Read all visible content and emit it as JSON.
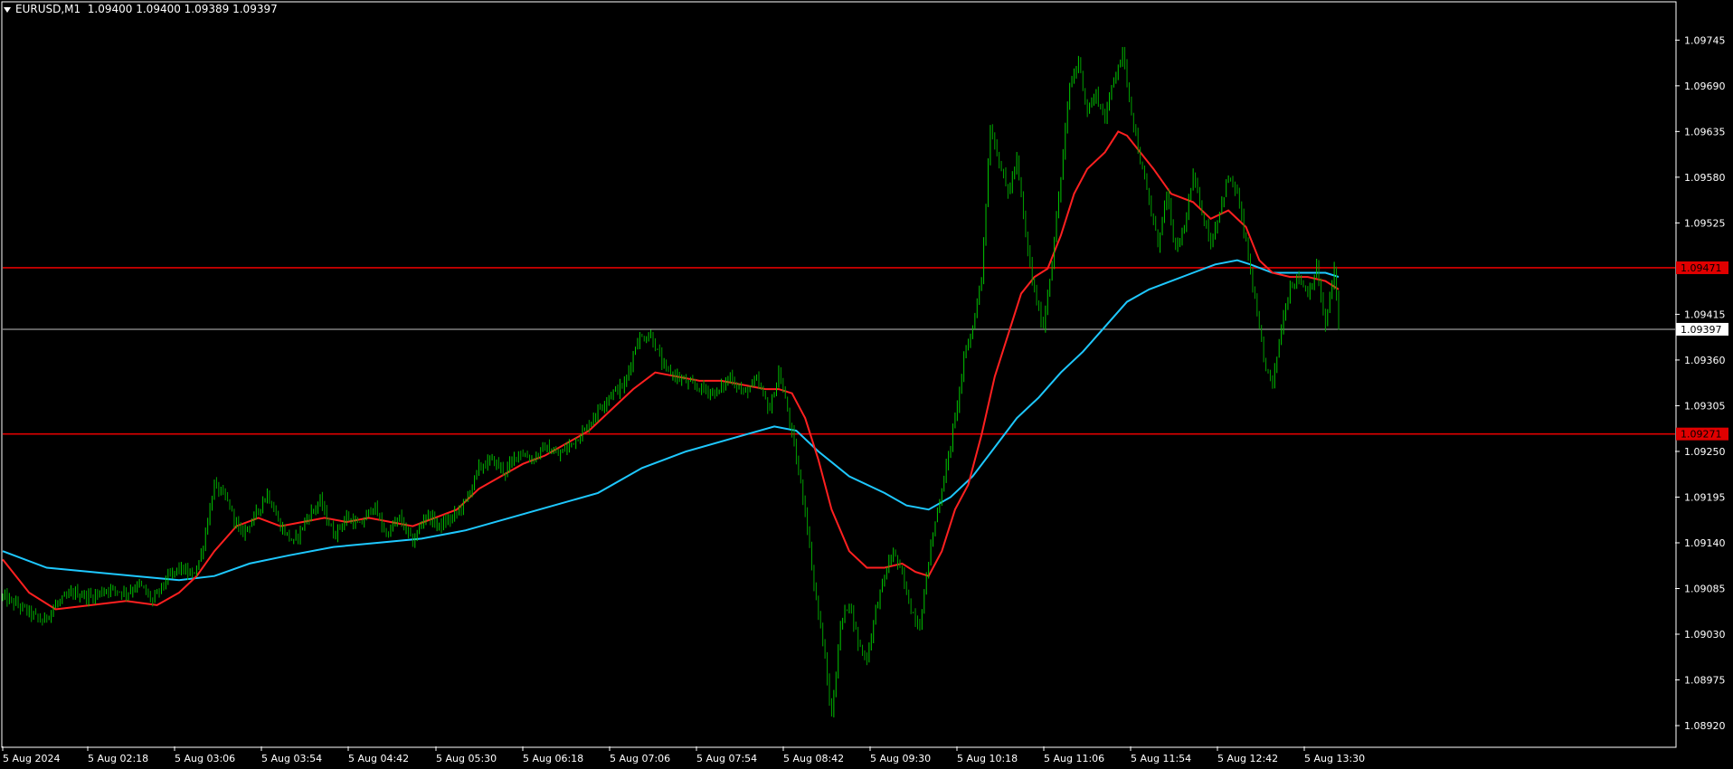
{
  "header": {
    "symbol": "EURUSD,M1",
    "ohlc": "1.09400 1.09400 1.09389 1.09397"
  },
  "colors": {
    "background": "#000000",
    "frame": "#ffffff",
    "candle_bull": "#00c800",
    "candle_bear": "#00a000",
    "ma_fast": "#ff2020",
    "ma_slow": "#1ec8ff",
    "hline": "#e00000",
    "price_line": "#bfbfbf",
    "label_red_bg": "#e00000",
    "label_white_bg": "#ffffff"
  },
  "chart_data": {
    "type": "candlestick",
    "ylim": [
      1.08895,
      1.0979
    ],
    "y_ticks": [
      "1.09745",
      "1.09690",
      "1.09635",
      "1.09580",
      "1.09525",
      "1.09415",
      "1.09360",
      "1.09305",
      "1.09250",
      "1.09195",
      "1.09140",
      "1.09085",
      "1.09030",
      "1.08975",
      "1.08920"
    ],
    "x_ticks": [
      "5 Aug 2024",
      "5 Aug 02:18",
      "5 Aug 03:06",
      "5 Aug 03:54",
      "5 Aug 04:42",
      "5 Aug 05:30",
      "5 Aug 06:18",
      "5 Aug 07:06",
      "5 Aug 07:54",
      "5 Aug 08:42",
      "5 Aug 09:30",
      "5 Aug 10:18",
      "5 Aug 11:06",
      "5 Aug 11:54",
      "5 Aug 12:42",
      "5 Aug 13:30"
    ],
    "horizontal_lines": [
      {
        "label": "1.09471",
        "value": 1.09471,
        "style": "red"
      },
      {
        "label": "1.09271",
        "value": 1.09271,
        "style": "red"
      }
    ],
    "current_price": {
      "label": "1.09397",
      "value": 1.09397
    },
    "price_path": [
      [
        0,
        1.09075
      ],
      [
        10,
        1.0906
      ],
      [
        18,
        1.09045
      ],
      [
        24,
        1.09065
      ],
      [
        32,
        1.0908
      ],
      [
        40,
        1.09075
      ],
      [
        48,
        1.09085
      ],
      [
        56,
        1.0908
      ],
      [
        62,
        1.0909
      ],
      [
        68,
        1.0907
      ],
      [
        74,
        1.09095
      ],
      [
        80,
        1.0911
      ],
      [
        86,
        1.091
      ],
      [
        90,
        1.09125
      ],
      [
        96,
        1.0921
      ],
      [
        102,
        1.0919
      ],
      [
        108,
        1.0915
      ],
      [
        114,
        1.0917
      ],
      [
        120,
        1.092
      ],
      [
        126,
        1.0916
      ],
      [
        132,
        1.0914
      ],
      [
        138,
        1.0917
      ],
      [
        144,
        1.0919
      ],
      [
        150,
        1.0915
      ],
      [
        156,
        1.0917
      ],
      [
        162,
        1.0916
      ],
      [
        168,
        1.09185
      ],
      [
        174,
        1.0915
      ],
      [
        180,
        1.0917
      ],
      [
        186,
        1.0914
      ],
      [
        192,
        1.09175
      ],
      [
        198,
        1.0916
      ],
      [
        204,
        1.0917
      ],
      [
        210,
        1.0919
      ],
      [
        216,
        1.0923
      ],
      [
        222,
        1.0924
      ],
      [
        228,
        1.09225
      ],
      [
        234,
        1.0925
      ],
      [
        240,
        1.0924
      ],
      [
        246,
        1.09255
      ],
      [
        252,
        1.09245
      ],
      [
        258,
        1.0926
      ],
      [
        264,
        1.09275
      ],
      [
        270,
        1.093
      ],
      [
        276,
        1.0932
      ],
      [
        282,
        1.0933
      ],
      [
        288,
        1.09385
      ],
      [
        294,
        1.0939
      ],
      [
        300,
        1.0935
      ],
      [
        306,
        1.0934
      ],
      [
        312,
        1.0933
      ],
      [
        318,
        1.09325
      ],
      [
        324,
        1.0932
      ],
      [
        330,
        1.0934
      ],
      [
        336,
        1.0932
      ],
      [
        342,
        1.09335
      ],
      [
        348,
        1.093
      ],
      [
        352,
        1.09345
      ],
      [
        356,
        1.093
      ],
      [
        360,
        1.0924
      ],
      [
        364,
        1.0918
      ],
      [
        368,
        1.0909
      ],
      [
        372,
        1.0902
      ],
      [
        376,
        1.0893
      ],
      [
        380,
        1.0904
      ],
      [
        384,
        1.0907
      ],
      [
        388,
        1.0902
      ],
      [
        392,
        1.09
      ],
      [
        396,
        1.0906
      ],
      [
        400,
        1.091
      ],
      [
        404,
        1.0913
      ],
      [
        408,
        1.091
      ],
      [
        412,
        1.0906
      ],
      [
        416,
        1.0904
      ],
      [
        420,
        1.0912
      ],
      [
        424,
        1.0918
      ],
      [
        428,
        1.0923
      ],
      [
        432,
        1.0929
      ],
      [
        436,
        1.0936
      ],
      [
        440,
        1.094
      ],
      [
        444,
        1.0946
      ],
      [
        448,
        1.0964
      ],
      [
        452,
        1.096
      ],
      [
        456,
        1.0956
      ],
      [
        460,
        1.096
      ],
      [
        464,
        1.0951
      ],
      [
        468,
        1.0944
      ],
      [
        472,
        1.094
      ],
      [
        476,
        1.0948
      ],
      [
        480,
        1.0958
      ],
      [
        484,
        1.0969
      ],
      [
        488,
        1.0972
      ],
      [
        492,
        1.0966
      ],
      [
        496,
        1.0968
      ],
      [
        500,
        1.0965
      ],
      [
        504,
        1.097
      ],
      [
        508,
        1.0973
      ],
      [
        512,
        1.0966
      ],
      [
        516,
        1.096
      ],
      [
        520,
        1.0955
      ],
      [
        524,
        1.095
      ],
      [
        528,
        1.0956
      ],
      [
        532,
        1.0949
      ],
      [
        536,
        1.0952
      ],
      [
        540,
        1.0958
      ],
      [
        544,
        1.0954
      ],
      [
        548,
        1.095
      ],
      [
        552,
        1.0954
      ],
      [
        556,
        1.0958
      ],
      [
        560,
        1.0956
      ],
      [
        564,
        1.095
      ],
      [
        568,
        1.0943
      ],
      [
        572,
        1.0936
      ],
      [
        576,
        1.0933
      ],
      [
        580,
        1.094
      ],
      [
        584,
        1.0945
      ],
      [
        588,
        1.0946
      ],
      [
        592,
        1.0944
      ],
      [
        596,
        1.0947
      ],
      [
        600,
        1.094
      ],
      [
        604,
        1.0947
      ],
      [
        606,
        1.09397
      ]
    ],
    "ma_fast_path": [
      [
        0,
        1.0912
      ],
      [
        12,
        1.0908
      ],
      [
        24,
        1.0906
      ],
      [
        40,
        1.09065
      ],
      [
        56,
        1.0907
      ],
      [
        70,
        1.09065
      ],
      [
        80,
        1.0908
      ],
      [
        88,
        1.091
      ],
      [
        96,
        1.0913
      ],
      [
        106,
        1.0916
      ],
      [
        116,
        1.0917
      ],
      [
        126,
        1.0916
      ],
      [
        136,
        1.09165
      ],
      [
        146,
        1.0917
      ],
      [
        156,
        1.09165
      ],
      [
        166,
        1.0917
      ],
      [
        176,
        1.09165
      ],
      [
        186,
        1.0916
      ],
      [
        196,
        1.0917
      ],
      [
        206,
        1.0918
      ],
      [
        216,
        1.09205
      ],
      [
        226,
        1.0922
      ],
      [
        236,
        1.09235
      ],
      [
        246,
        1.09245
      ],
      [
        256,
        1.0926
      ],
      [
        266,
        1.09275
      ],
      [
        276,
        1.093
      ],
      [
        286,
        1.09325
      ],
      [
        296,
        1.09345
      ],
      [
        306,
        1.0934
      ],
      [
        316,
        1.09335
      ],
      [
        326,
        1.09335
      ],
      [
        336,
        1.0933
      ],
      [
        346,
        1.09325
      ],
      [
        352,
        1.09325
      ],
      [
        358,
        1.0932
      ],
      [
        364,
        1.0929
      ],
      [
        370,
        1.0924
      ],
      [
        376,
        1.0918
      ],
      [
        384,
        1.0913
      ],
      [
        392,
        1.0911
      ],
      [
        400,
        1.0911
      ],
      [
        408,
        1.09115
      ],
      [
        414,
        1.09105
      ],
      [
        420,
        1.091
      ],
      [
        426,
        1.0913
      ],
      [
        432,
        1.0918
      ],
      [
        438,
        1.0921
      ],
      [
        444,
        1.0927
      ],
      [
        450,
        1.0934
      ],
      [
        456,
        1.0939
      ],
      [
        462,
        1.0944
      ],
      [
        468,
        1.0946
      ],
      [
        474,
        1.0947
      ],
      [
        480,
        1.0951
      ],
      [
        486,
        1.0956
      ],
      [
        492,
        1.0959
      ],
      [
        500,
        1.0961
      ],
      [
        506,
        1.09635
      ],
      [
        510,
        1.0963
      ],
      [
        516,
        1.0961
      ],
      [
        522,
        1.0959
      ],
      [
        530,
        1.0956
      ],
      [
        540,
        1.0955
      ],
      [
        548,
        1.0953
      ],
      [
        556,
        1.0954
      ],
      [
        564,
        1.0952
      ],
      [
        570,
        1.0948
      ],
      [
        576,
        1.09465
      ],
      [
        584,
        1.0946
      ],
      [
        592,
        1.0946
      ],
      [
        600,
        1.09455
      ],
      [
        606,
        1.09445
      ]
    ],
    "ma_slow_path": [
      [
        0,
        1.0913
      ],
      [
        20,
        1.0911
      ],
      [
        40,
        1.09105
      ],
      [
        60,
        1.091
      ],
      [
        80,
        1.09095
      ],
      [
        96,
        1.091
      ],
      [
        112,
        1.09115
      ],
      [
        130,
        1.09125
      ],
      [
        150,
        1.09135
      ],
      [
        170,
        1.0914
      ],
      [
        190,
        1.09145
      ],
      [
        210,
        1.09155
      ],
      [
        230,
        1.0917
      ],
      [
        250,
        1.09185
      ],
      [
        270,
        1.092
      ],
      [
        290,
        1.0923
      ],
      [
        310,
        1.0925
      ],
      [
        330,
        1.09265
      ],
      [
        350,
        1.0928
      ],
      [
        360,
        1.09275
      ],
      [
        370,
        1.0925
      ],
      [
        384,
        1.0922
      ],
      [
        400,
        1.092
      ],
      [
        410,
        1.09185
      ],
      [
        420,
        1.0918
      ],
      [
        430,
        1.09195
      ],
      [
        440,
        1.0922
      ],
      [
        450,
        1.09255
      ],
      [
        460,
        1.0929
      ],
      [
        470,
        1.09315
      ],
      [
        480,
        1.09345
      ],
      [
        490,
        1.0937
      ],
      [
        500,
        1.094
      ],
      [
        510,
        1.0943
      ],
      [
        520,
        1.09445
      ],
      [
        530,
        1.09455
      ],
      [
        540,
        1.09465
      ],
      [
        550,
        1.09475
      ],
      [
        560,
        1.0948
      ],
      [
        566,
        1.09475
      ],
      [
        576,
        1.09465
      ],
      [
        590,
        1.09465
      ],
      [
        600,
        1.09465
      ],
      [
        606,
        1.0946
      ]
    ]
  }
}
